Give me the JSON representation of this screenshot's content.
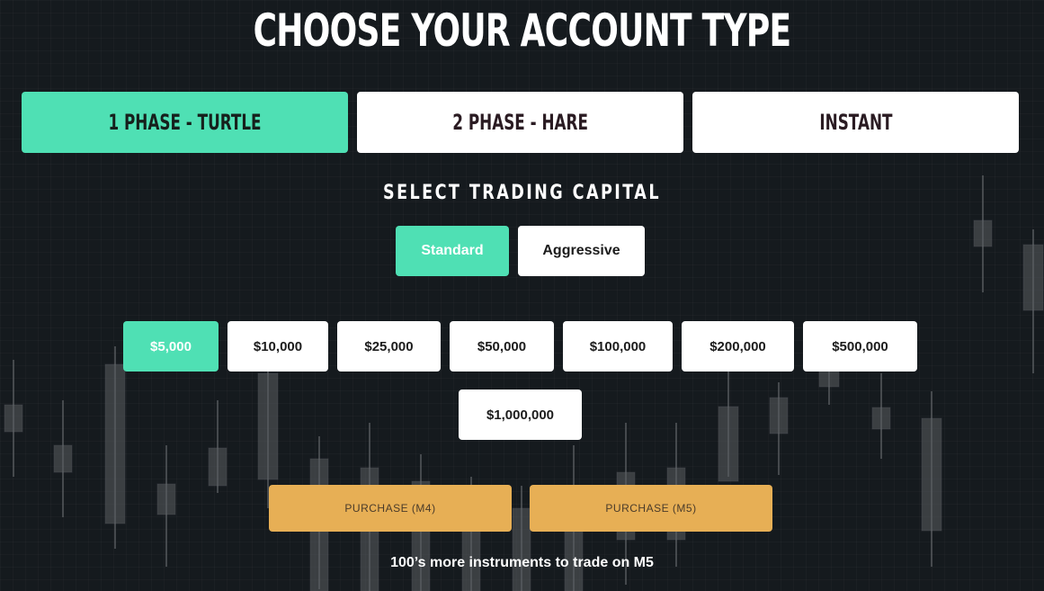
{
  "page": {
    "title": "CHOOSE YOUR ACCOUNT TYPE",
    "subtitle": "SELECT TRADING CAPITAL",
    "note": "100’s more instruments to trade on M5"
  },
  "account_tabs": [
    {
      "label": "1 PHASE - TURTLE",
      "selected": true
    },
    {
      "label": "2 PHASE - HARE",
      "selected": false
    },
    {
      "label": "INSTANT",
      "selected": false
    }
  ],
  "modes": [
    {
      "label": "Standard",
      "selected": true
    },
    {
      "label": "Aggressive",
      "selected": false
    }
  ],
  "capital_options": [
    {
      "label": "$5,000",
      "selected": true
    },
    {
      "label": "$10,000",
      "selected": false
    },
    {
      "label": "$25,000",
      "selected": false
    },
    {
      "label": "$50,000",
      "selected": false
    },
    {
      "label": "$100,000",
      "selected": false
    },
    {
      "label": "$200,000",
      "selected": false
    },
    {
      "label": "$500,000",
      "selected": false
    },
    {
      "label": "$1,000,000",
      "selected": false
    }
  ],
  "purchase_buttons": [
    {
      "label": "PURCHASE (M4)"
    },
    {
      "label": "PURCHASE (M5)"
    }
  ],
  "colors": {
    "background": "#151a1e",
    "accent": "#4fe0b4",
    "purchase": "#e7af55",
    "candle": "#5a5e61"
  }
}
